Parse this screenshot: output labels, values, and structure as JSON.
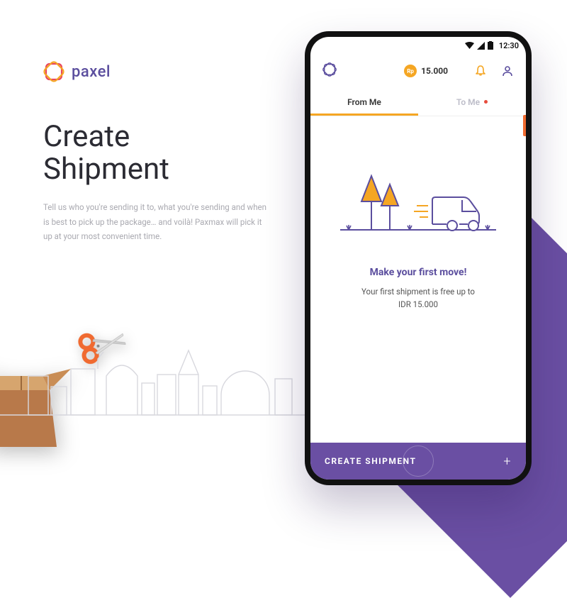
{
  "brand": {
    "name": "paxel"
  },
  "headline": "Create\nShipment",
  "subcopy": "Tell us who you're sending it to, what you're sending and when is best to pick up the package… and voilà! Paxmax will pick it up at your most convenient time.",
  "status_bar": {
    "time": "12:30"
  },
  "header": {
    "balance_currency": "Rp",
    "balance_amount": "15.000"
  },
  "tabs": {
    "from_me": "From Me",
    "to_me": "To Me"
  },
  "empty_state": {
    "title": "Make your first move!",
    "line1": "Your first shipment is free up to",
    "line2": "IDR 15.000"
  },
  "cta": {
    "label": "CREATE SHIPMENT",
    "plus": "+"
  },
  "colors": {
    "purple": "#6A4FA3",
    "purple_text": "#5B4E9E",
    "orange": "#F5A623",
    "accent_orange": "#F06A30"
  }
}
